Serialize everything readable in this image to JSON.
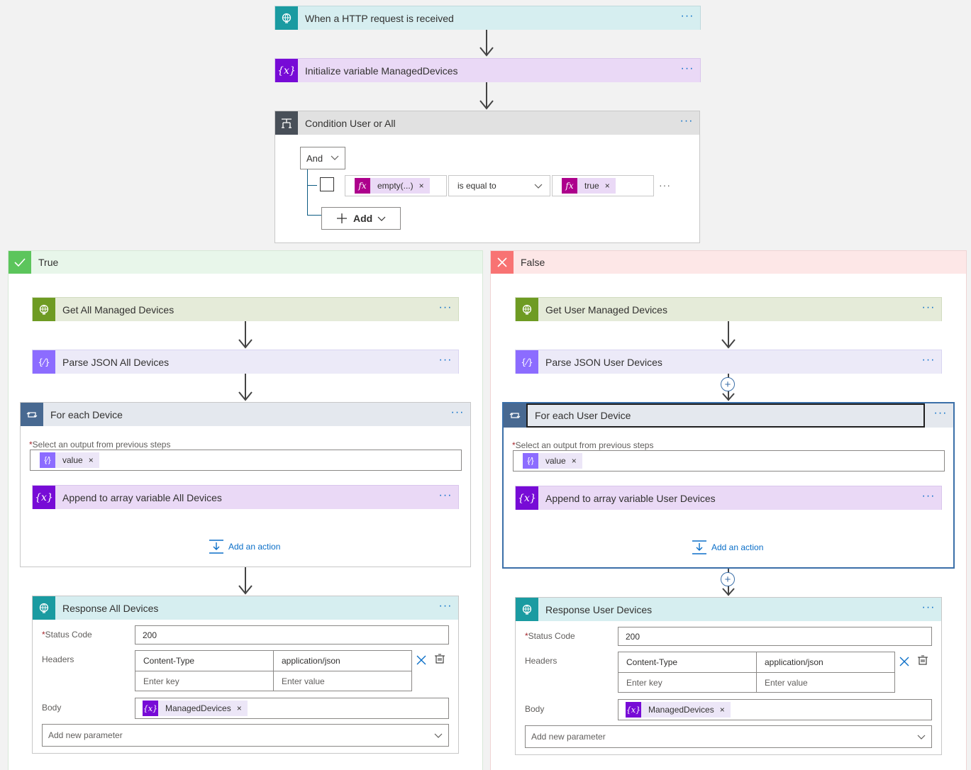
{
  "trigger": {
    "title": "When a HTTP request is received"
  },
  "init_var": {
    "title": "Initialize variable ManagedDevices"
  },
  "condition": {
    "title": "Condition User or All",
    "group_operator": "And",
    "left_token": "empty(...)",
    "operator": "is equal to",
    "right_token": "true",
    "add_label": "Add"
  },
  "true_branch": {
    "label": "True",
    "get": {
      "title": "Get All Managed Devices"
    },
    "parse": {
      "title": "Parse JSON All Devices"
    },
    "foreach": {
      "title": "For each Device",
      "select_label": "Select an output from previous steps",
      "token": "value",
      "append": {
        "title": "Append to array variable All Devices"
      },
      "add_action": "Add an action"
    },
    "response": {
      "title": "Response All Devices",
      "status_label": "Status Code",
      "status_value": "200",
      "headers_label": "Headers",
      "header_key": "Content-Type",
      "header_value": "application/json",
      "key_placeholder": "Enter key",
      "value_placeholder": "Enter value",
      "body_label": "Body",
      "body_token": "ManagedDevices",
      "add_param": "Add new parameter"
    }
  },
  "false_branch": {
    "label": "False",
    "get": {
      "title": "Get User Managed Devices"
    },
    "parse": {
      "title": "Parse JSON User Devices"
    },
    "foreach": {
      "title": "For each User Device",
      "select_label": "Select an output from previous steps",
      "token": "value",
      "append": {
        "title": "Append to array variable User Devices"
      },
      "add_action": "Add an action"
    },
    "response": {
      "title": "Response User Devices",
      "status_label": "Status Code",
      "status_value": "200",
      "headers_label": "Headers",
      "header_key": "Content-Type",
      "header_value": "application/json",
      "key_placeholder": "Enter key",
      "value_placeholder": "Enter value",
      "body_label": "Body",
      "body_token": "ManagedDevices",
      "add_param": "Add new parameter"
    }
  },
  "icons": {
    "http": "globe-icon",
    "variable": "variable-icon",
    "condition": "condition-icon",
    "foreach": "loop-icon",
    "parse": "parse-json-icon",
    "fx": "function-icon"
  },
  "colors": {
    "http_teal": "#1a9ba1",
    "http_header": "#d6eef0",
    "variable_purple": "#770bd6",
    "variable_header": "#ead9f6",
    "condition_dark": "#484f58",
    "condition_header": "#e1e1e1",
    "http_green": "#6e9b23",
    "http_green_header": "#e5ebd9",
    "parse_purple": "#8c6cff",
    "parse_header": "#eceaf8",
    "loop_blue": "#486991",
    "loop_header": "#e4e8ee",
    "true_green": "#5cc55c",
    "true_header": "#e8f6ea",
    "false_red": "#f87373",
    "false_header": "#fde7e7",
    "link_blue": "#0b6fc8"
  }
}
